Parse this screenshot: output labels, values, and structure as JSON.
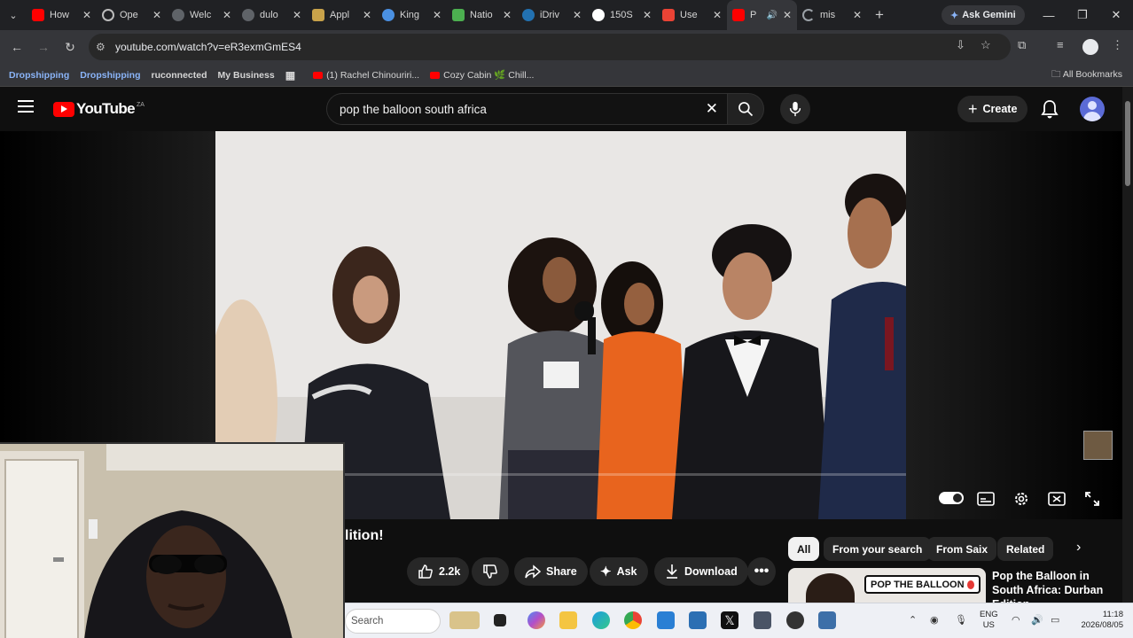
{
  "browser": {
    "tabs": [
      {
        "title": "How",
        "favicon": "youtube-icon",
        "color": "#ff0000"
      },
      {
        "title": "Ope",
        "favicon": "openai-icon",
        "color": "#bbbbbb"
      },
      {
        "title": "Welc",
        "favicon": "globe-icon",
        "color": "#9aa0a6"
      },
      {
        "title": "dulo",
        "favicon": "globe-icon",
        "color": "#9aa0a6"
      },
      {
        "title": "Appl",
        "favicon": "crest-icon",
        "color": "#c8a24a"
      },
      {
        "title": "King",
        "favicon": "kings-icon",
        "color": "#4a90e2"
      },
      {
        "title": "Natio",
        "favicon": "map-icon",
        "color": "#4caf50"
      },
      {
        "title": "iDriv",
        "favicon": "wordpress-icon",
        "color": "#2271b1"
      },
      {
        "title": "150S",
        "favicon": "google-icon",
        "color": "#ffffff"
      },
      {
        "title": "Use",
        "favicon": "gmail-icon",
        "color": "#ea4335"
      },
      {
        "title": "P",
        "favicon": "youtube-icon",
        "color": "#ff0000",
        "active": true
      },
      {
        "title": "mis",
        "favicon": "loading-icon",
        "color": "#9aa0a6"
      }
    ],
    "new_tab": "+",
    "ask_gemini": "Ask Gemini",
    "url": "youtube.com/watch?v=eR3exmGmES4",
    "bookmarks": [
      {
        "label": "Dropshipping",
        "style": "blue"
      },
      {
        "label": "Dropshipping",
        "style": "blue"
      },
      {
        "label": "ruconnected",
        "style": "plain"
      },
      {
        "label": "My Business",
        "style": "plain"
      },
      {
        "label": "(1) Rachel Chinouriri...",
        "style": "yt"
      },
      {
        "label": "Cozy Cabin 🌿 Chill...",
        "style": "yt"
      }
    ],
    "all_bookmarks": "All Bookmarks"
  },
  "youtube": {
    "logo_text": "YouTube",
    "country": "ZA",
    "search_query": "pop the balloon south africa",
    "create_label": "Create",
    "title_tail": "lition!",
    "actions": {
      "likes": "2.2k",
      "share": "Share",
      "ask": "Ask",
      "download": "Download"
    },
    "chips": [
      "All",
      "From your search",
      "From Saix",
      "Related"
    ],
    "recommended": {
      "badge": "POP THE BALLOON",
      "title": "Pop the Balloon in South Africa: Durban Edition"
    }
  },
  "taskbar": {
    "search_placeholder": "Search",
    "lang_top": "ENG",
    "lang_bottom": "US",
    "time": "11:18",
    "date": "2026/08/05"
  },
  "colors": {
    "brand_red": "#ff0000",
    "page_bg": "#0f0f0f",
    "chrome_bg": "#35363a"
  }
}
